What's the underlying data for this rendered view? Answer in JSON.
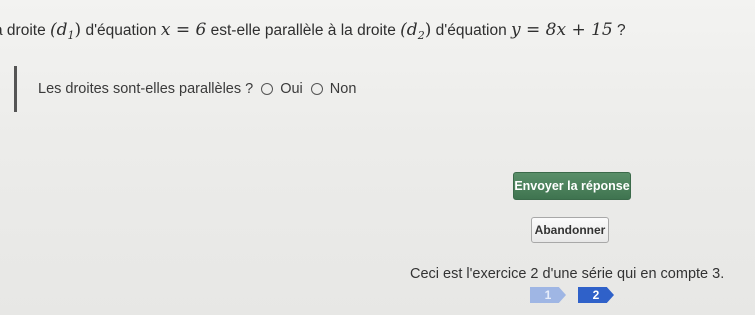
{
  "question": {
    "part1": "a droite ",
    "d1": "(d",
    "d1_sub": "1",
    "d1_close": ")",
    "part2": " d'équation ",
    "eq1": "x = 6",
    "part3": " est-elle parallèle à la droite ",
    "d2": "(d",
    "d2_sub": "2",
    "d2_close": ")",
    "part4": " d'équation ",
    "eq2": "y = 8x + 15",
    "part5": " ?"
  },
  "answer": {
    "prompt": "Les droites sont-elles parallèles ?",
    "option_yes": "Oui",
    "option_no": "Non"
  },
  "buttons": {
    "submit": "Envoyer la réponse",
    "cancel": "Abandonner"
  },
  "footer": {
    "info": "Ceci est l'exercice 2 d'une série qui en compte 3.",
    "steps": [
      "1",
      "2"
    ]
  },
  "colors": {
    "submit_bg": "#4a7f5a",
    "step_current": "#2f61c9",
    "step_done": "#9fb6e4"
  }
}
